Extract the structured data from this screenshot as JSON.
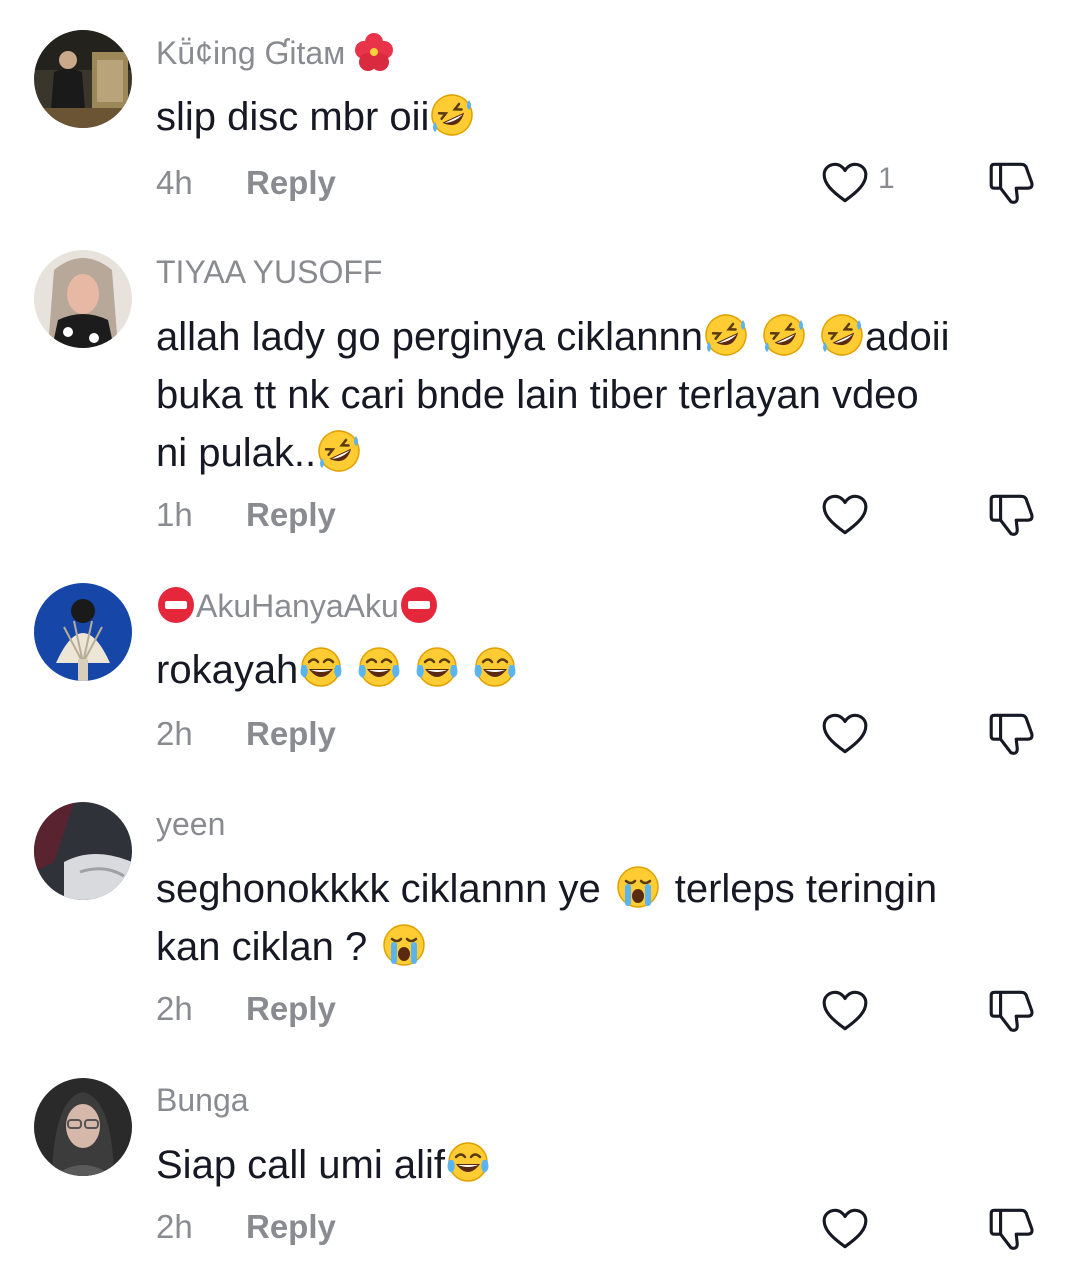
{
  "comments": [
    {
      "username": "Kṻ¢ing Ɠitaм",
      "text": "slip disc mbr oii",
      "time": "4h",
      "reply": "Reply",
      "likes": "1",
      "avatar_colors": [
        "#2b2a25",
        "#8c7a55"
      ]
    },
    {
      "username": "TIYAA YUSOFF",
      "text_line1": "allah lady go perginya ciklannn",
      "text_line1b": "adoii",
      "text_line2": "buka tt nk cari bnde lain tiber terlayan vdeo",
      "text_line3": "ni pulak..",
      "time": "1h",
      "reply": "Reply",
      "likes": "",
      "avatar_colors": [
        "#d9c7b8",
        "#1d1d1d"
      ]
    },
    {
      "username": "AkuHanyaAku",
      "text": "rokayah",
      "time": "2h",
      "reply": "Reply",
      "likes": "",
      "avatar_colors": [
        "#1a4aa8",
        "#e8e2d4"
      ]
    },
    {
      "username": "yeen",
      "text_line1a": "seghonokkkk ciklannn ye",
      "text_line1b": "terleps teringin",
      "text_line2": "kan ciklan ?",
      "time": "2h",
      "reply": "Reply",
      "likes": "",
      "avatar_colors": [
        "#3a3d44",
        "#c8c9cc"
      ]
    },
    {
      "username": "Bunga",
      "text": "Siap call umi alif",
      "time": "2h",
      "reply": "Reply",
      "likes": "",
      "avatar_colors": [
        "#2c2c2c",
        "#d2b6a8"
      ]
    }
  ],
  "icons": {
    "like": "heart-outline-icon",
    "dislike": "thumbs-down-icon",
    "rofl": "rolling-on-floor-laughing-emoji",
    "tears_of_joy": "face-with-tears-of-joy-emoji",
    "crying": "loudly-crying-face-emoji",
    "hibiscus": "hibiscus-emoji",
    "no_entry": "no-entry-emoji"
  }
}
